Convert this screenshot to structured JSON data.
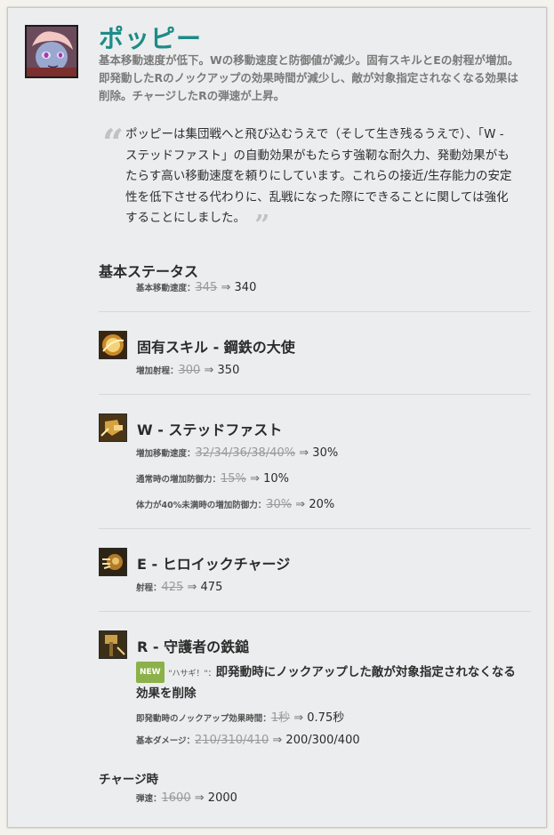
{
  "champion": {
    "name": "ポッピー",
    "summary": "基本移動速度が低下。Wの移動速度と防御値が減少。固有スキルとEの射程が増加。即発動したRのノックアップの効果時間が減少し、敵が対象指定されなくなる効果は削除。チャージしたRの弾速が上昇。",
    "quote": "ポッピーは集団戦へと飛び込むうえで（そして生き残るうえで）、「W - ステッドファスト」の自動効果がもたらす強靭な耐久力、発動効果がもたらす高い移動速度を頼りにしています。これらの接近/生存能力の安定性を低下させる代わりに、乱戦になった際にできることに関しては強化することにしました。"
  },
  "base_stats": {
    "title": "基本ステータス",
    "stats": [
      {
        "label": "基本移動速度：",
        "old": "345",
        "new": "340"
      }
    ]
  },
  "abilities": [
    {
      "icon": "passive-shield-icon",
      "title": "固有スキル - 鋼鉄の大使",
      "stats": [
        {
          "label": "増加射程：",
          "old": "300",
          "new": "350"
        }
      ]
    },
    {
      "icon": "steadfast-icon",
      "title": "W - ステッドファスト",
      "stats": [
        {
          "label": "増加移動速度：",
          "old": "32/34/36/38/40%",
          "new": "30%"
        },
        {
          "label": "通常時の増加防御力：",
          "old": "15%",
          "new": "10%"
        },
        {
          "label": "体力が40%未満時の増加防御力：",
          "old": "30%",
          "new": "20%"
        }
      ]
    },
    {
      "icon": "heroic-charge-icon",
      "title": "E - ヒロイックチャージ",
      "stats": [
        {
          "label": "射程：",
          "old": "425",
          "new": "475"
        }
      ]
    },
    {
      "icon": "keepers-verdict-icon",
      "title": "R - 守護者の鉄鎚",
      "new_badge": "NEW",
      "new_label": "\"ハサギ！\"：",
      "new_text": "即発動時にノックアップした敵が対象指定されなくなる効果を削除",
      "stats": [
        {
          "label": "即発動時のノックアップ効果時間：",
          "old": "1秒",
          "new": "0.75秒"
        },
        {
          "label": "基本ダメージ：",
          "old": "210/310/410",
          "new": "200/300/400"
        }
      ],
      "sub_title": "チャージ時",
      "sub_stats": [
        {
          "label": "弾速：",
          "old": "1600",
          "new": "2000"
        }
      ]
    }
  ],
  "arrow": "⇒"
}
